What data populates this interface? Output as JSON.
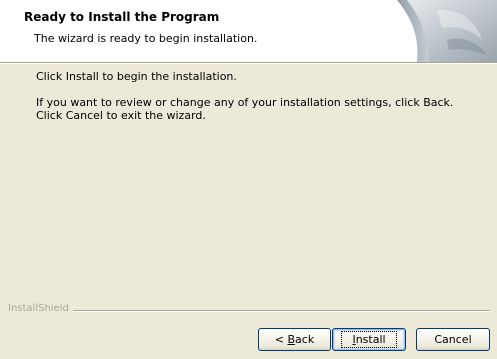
{
  "header": {
    "title": "Ready to Install the Program",
    "subtitle": "The wizard is ready to begin installation."
  },
  "body": {
    "line1": "Click Install to begin the installation.",
    "line2": "If you want to review or change any of your installation settings, click Back. Click Cancel to exit the wizard."
  },
  "footer": {
    "brand": "InstallShield"
  },
  "buttons": {
    "back_prefix": "< ",
    "back_mnemonic": "B",
    "back_rest": "ack",
    "install_mnemonic": "I",
    "install_rest": "nstall",
    "cancel": "Cancel"
  },
  "colors": {
    "background": "#ece9d8",
    "header_bg": "#ffffff",
    "button_border": "#003c74",
    "etched_line": "#aca899"
  },
  "icons": {
    "header_graphic": "page-curl-graphic"
  }
}
